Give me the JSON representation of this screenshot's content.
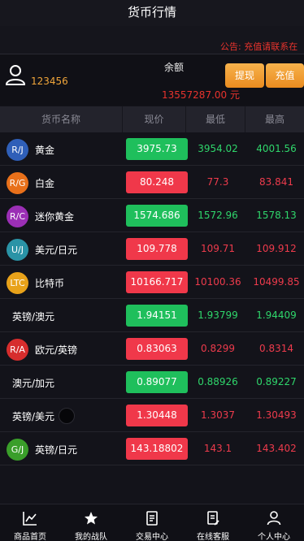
{
  "header": {
    "title": "货币行情"
  },
  "notice": {
    "text": "公告: 充值请联系在"
  },
  "account": {
    "username": "123456",
    "balance_label": "余额",
    "balance_value": "13557287.00 元",
    "withdraw_label": "提现",
    "recharge_label": "充值"
  },
  "table": {
    "columns": [
      "货币名称",
      "现价",
      "最低",
      "最高"
    ],
    "rows": [
      {
        "icon": "R/J",
        "icon_color": "#2f5fb8",
        "name": "黄金",
        "price": "3975.73",
        "trend": "up",
        "low": "3954.02",
        "high": "4001.56"
      },
      {
        "icon": "R/G",
        "icon_color": "#e8701a",
        "name": "白金",
        "price": "80.248",
        "trend": "down",
        "low": "77.3",
        "high": "83.841"
      },
      {
        "icon": "R/C",
        "icon_color": "#9b2fb5",
        "name": "迷你黄金",
        "price": "1574.686",
        "trend": "up",
        "low": "1572.96",
        "high": "1578.13"
      },
      {
        "icon": "U/J",
        "icon_color": "#2a93a6",
        "name": "美元/日元",
        "price": "109.778",
        "trend": "down",
        "low": "109.71",
        "high": "109.912"
      },
      {
        "icon": "LTC",
        "icon_color": "#e8a21a",
        "name": "比特币",
        "price": "10166.717",
        "trend": "down",
        "low": "10100.36",
        "high": "10499.85"
      },
      {
        "icon": "",
        "icon_color": "",
        "name": "英镑/澳元",
        "price": "1.94151",
        "trend": "up",
        "low": "1.93799",
        "high": "1.94409"
      },
      {
        "icon": "R/A",
        "icon_color": "#d62d2d",
        "name": "欧元/英镑",
        "price": "0.83063",
        "trend": "down",
        "low": "0.8299",
        "high": "0.8314"
      },
      {
        "icon": "",
        "icon_color": "",
        "name": "澳元/加元",
        "price": "0.89077",
        "trend": "up",
        "low": "0.88926",
        "high": "0.89227"
      },
      {
        "icon": "",
        "icon_color": "",
        "name": "英镑/美元",
        "price": "1.30448",
        "trend": "down",
        "low": "1.3037",
        "high": "1.30493"
      },
      {
        "icon": "G/J",
        "icon_color": "#3a9e2a",
        "name": "英镑/日元",
        "price": "143.18802",
        "trend": "down",
        "low": "143.1",
        "high": "143.402"
      }
    ]
  },
  "tabbar": {
    "items": [
      {
        "label": "商品首页",
        "icon": "chart-icon"
      },
      {
        "label": "我的战队",
        "icon": "star-icon"
      },
      {
        "label": "交易中心",
        "icon": "document-icon"
      },
      {
        "label": "在线客服",
        "icon": "document-edit-icon"
      },
      {
        "label": "个人中心",
        "icon": "person-icon"
      }
    ]
  }
}
